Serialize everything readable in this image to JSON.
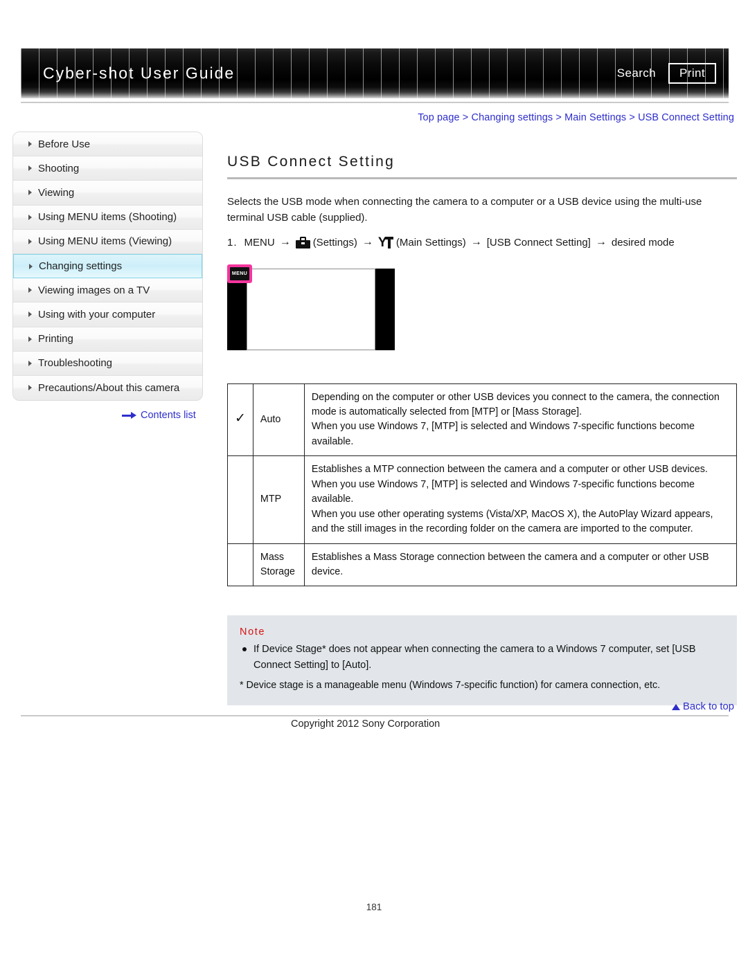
{
  "header": {
    "title": "Cyber-shot User Guide",
    "search_label": "Search",
    "print_label": "Print"
  },
  "breadcrumb": {
    "text": "Top page > Changing settings > Main Settings > USB Connect Setting"
  },
  "sidebar": {
    "items": [
      {
        "label": "Before Use",
        "active": false
      },
      {
        "label": "Shooting",
        "active": false
      },
      {
        "label": "Viewing",
        "active": false
      },
      {
        "label": "Using MENU items (Shooting)",
        "active": false
      },
      {
        "label": "Using MENU items (Viewing)",
        "active": false
      },
      {
        "label": "Changing settings",
        "active": true
      },
      {
        "label": "Viewing images on a TV",
        "active": false
      },
      {
        "label": "Using with your computer",
        "active": false
      },
      {
        "label": "Printing",
        "active": false
      },
      {
        "label": "Troubleshooting",
        "active": false
      },
      {
        "label": "Precautions/About this camera",
        "active": false
      }
    ],
    "contents_link": "Contents list"
  },
  "main": {
    "title": "USB Connect Setting",
    "intro": "Selects the USB mode when connecting the camera to a computer or a USB device using the multi-use terminal USB cable (supplied).",
    "step": {
      "number": "1.",
      "menu": "MENU",
      "arrow": "→",
      "settings_label": "(Settings)",
      "main_settings_label": "(Main Settings)",
      "bracket_item": "[USB Connect Setting]",
      "result": "desired mode"
    },
    "illustration": {
      "menu_chip_label": "MENU"
    },
    "options_table": {
      "rows": [
        {
          "checked": "✓",
          "name": "Auto",
          "description": "Depending on the computer or other USB devices you connect to the camera, the connection mode is automatically selected from [MTP] or [Mass Storage].\nWhen you use Windows 7, [MTP] is selected and Windows 7-specific functions become available."
        },
        {
          "checked": "",
          "name": "MTP",
          "description": "Establishes a MTP connection between the camera and a computer or other USB devices.\nWhen you use Windows 7, [MTP] is selected and Windows 7-specific functions become available.\nWhen you use other operating systems (Vista/XP, MacOS X), the AutoPlay Wizard appears, and the still images in the recording folder on the camera are imported to the computer."
        },
        {
          "checked": "",
          "name": "Mass Storage",
          "description": "Establishes a Mass Storage connection between the camera and a computer or other USB device."
        }
      ]
    },
    "note": {
      "title": "Note",
      "bullets": [
        "If Device Stage* does not appear when connecting the camera to a Windows 7 computer, set [USB Connect Setting] to [Auto]."
      ],
      "footnote": "* Device stage is a manageable menu (Windows 7-specific function) for camera connection, etc."
    }
  },
  "footer": {
    "back_to_top": "Back to top",
    "copyright": "Copyright 2012 Sony Corporation",
    "page_number": "181"
  },
  "colors": {
    "link": "#2e2ecc",
    "accent_pink": "#f5359e",
    "note_red": "#d81212",
    "note_bg": "#e2e6ea",
    "active_nav": "#cdeffa"
  }
}
